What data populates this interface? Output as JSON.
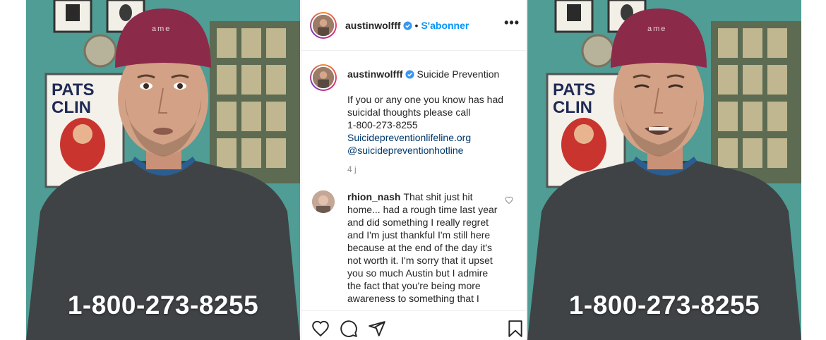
{
  "video_left": {
    "overlay_text": "1-800-273-8255",
    "cap_text": "ame",
    "poster_text": "PATS\nCLIN"
  },
  "video_right": {
    "overlay_text": "1-800-273-8255",
    "cap_text": "ame",
    "poster_text": "PATS\nCLIN"
  },
  "post": {
    "header": {
      "username": "austinwolfff",
      "follow_label": "S'abonner",
      "more_label": "•••"
    },
    "caption": {
      "username": "austinwolfff",
      "location": "Suicide Prevention",
      "lines": [
        "If you or any one you know has had",
        "suicidal thoughts please call",
        "1-800-273-8255"
      ],
      "link_site": "Suicidepreventionlifeline.org",
      "link_handle": "@suicidepreventionhotline",
      "time_ago": "4 j"
    },
    "comment": {
      "username": "rhion_nash",
      "text": "That shit just hit home... had a rough time last year and did something I really regret and I'm just thankful I'm still here because at the end of the day it's not worth it. I'm sorry that it upset you so much Austin but I admire the fact that you're being more awareness to something that I"
    },
    "actions": [
      "heart-icon",
      "comment-icon",
      "share-icon",
      "bookmark-icon"
    ]
  },
  "colors": {
    "follow": "#0095f6",
    "link": "#00376b",
    "muted": "#8e8e8e",
    "wall": "#4e9b92",
    "cap": "#8c2a4a",
    "shirt": "#3f4346"
  }
}
